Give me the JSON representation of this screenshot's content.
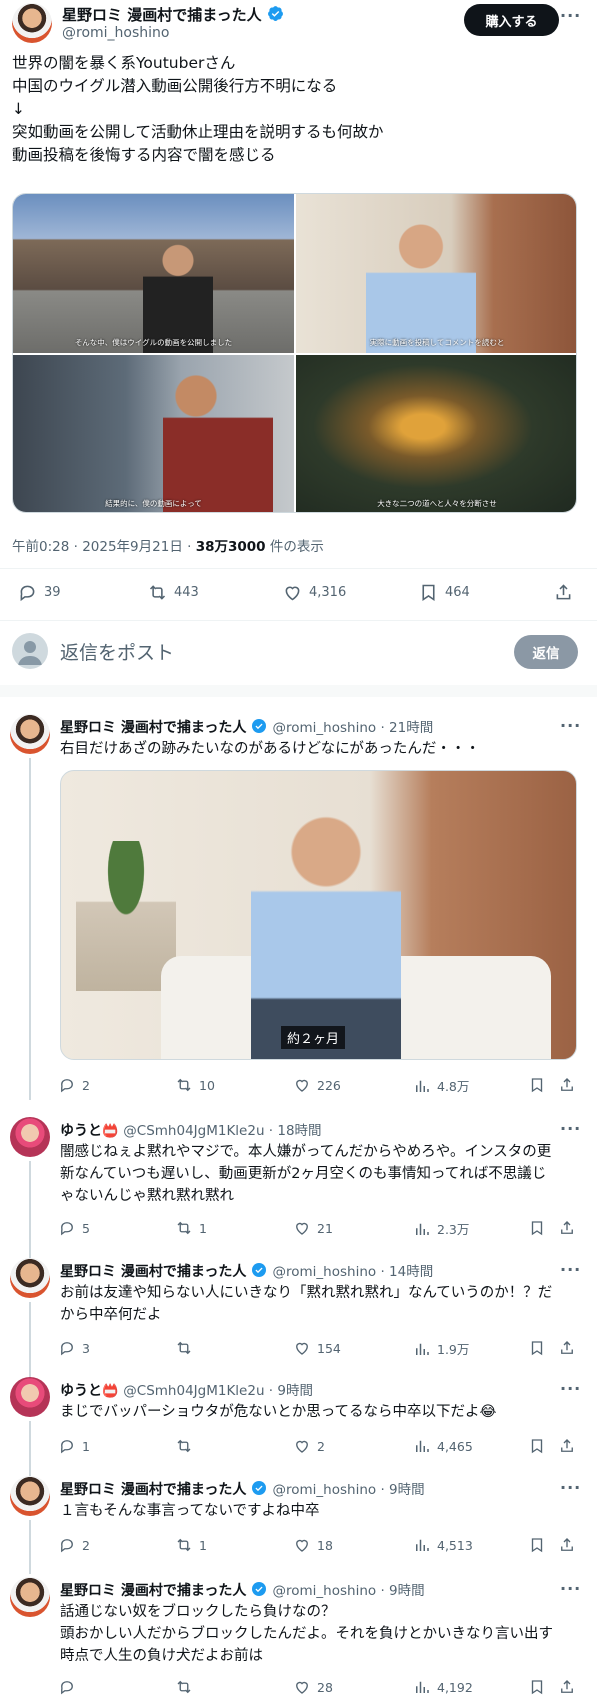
{
  "main_post": {
    "author_name": "星野ロミ 漫画村で捕まった人",
    "author_handle": "@romi_hoshino",
    "buy_button": "購入する",
    "lines": [
      "世界の闇を暴く系Youtuberさん",
      "中国のウイグル潜入動画公開後行方不明になる",
      "↓",
      "突如動画を公開して活動休止理由を説明するも何故か",
      "動画投稿を後悔する内容で闇を感じる"
    ],
    "image_captions": [
      "そんな中、僕はウイグルの動画を公開しました",
      "実際に動画を投稿してコメントを読むと",
      "結果的に、僕の動画によって",
      "大きな二つの道へと人々を分断させ"
    ],
    "timestamp": "午前0:28 · 2025年9月21日 · ",
    "views": "38万3000",
    "views_suffix": " 件の表示",
    "replies": "39",
    "reposts": "443",
    "likes": "4,316",
    "bookmarks": "464"
  },
  "reply_box": {
    "placeholder": "返信をポスト",
    "button": "返信"
  },
  "replies": [
    {
      "name": "星野ロミ 漫画村で捕まった人",
      "handle": "@romi_hoshino · 21時間",
      "verified": true,
      "lines": [
        "右目だけあざの跡みたいなのがあるけどなにがあったんだ・・・"
      ],
      "image_caption": "約２ヶ月",
      "replies": "2",
      "reposts": "10",
      "likes": "226",
      "views": "4.8万"
    },
    {
      "name": "ゆうと",
      "badge": "📛",
      "handle": "@CSmh04JgM1Kle2u · 18時間",
      "verified": false,
      "lines": [
        "闇感じねぇよ黙れやマジで。本人嫌がってんだからやめろや。インスタの更",
        "新なんていつも遅いし、動画更新が2ヶ月空くのも事情知ってれば不思議じ",
        "ゃないんじゃ黙れ黙れ黙れ"
      ],
      "replies": "5",
      "reposts": "1",
      "likes": "21",
      "views": "2.3万"
    },
    {
      "name": "星野ロミ 漫画村で捕まった人",
      "handle": "@romi_hoshino · 14時間",
      "verified": true,
      "lines": [
        "お前は友達や知らない人にいきなり「黙れ黙れ黙れ」なんていうのか！？だ",
        "から中卒何だよ"
      ],
      "replies": "3",
      "reposts": "",
      "likes": "154",
      "views": "1.9万"
    },
    {
      "name": "ゆうと",
      "badge": "📛",
      "handle": "@CSmh04JgM1Kle2u · 9時間",
      "verified": false,
      "lines": [
        "まじでバッパーショウタが危ないとか思ってるなら中卒以下だよ😂"
      ],
      "replies": "1",
      "reposts": "",
      "likes": "2",
      "views": "4,465"
    },
    {
      "name": "星野ロミ 漫画村で捕まった人",
      "handle": "@romi_hoshino · 9時間",
      "verified": true,
      "lines": [
        "１言もそんな事言ってないですよね中卒"
      ],
      "replies": "2",
      "reposts": "1",
      "likes": "18",
      "views": "4,513"
    },
    {
      "name": "星野ロミ 漫画村で捕まった人",
      "handle": "@romi_hoshino · 9時間",
      "verified": true,
      "lines": [
        "話通じない奴をブロックしたら負けなの？",
        "頭おかしい人だからブロックしたんだよ。それを負けとかいきなり言い出す",
        "時点で人生の負け犬だよお前は"
      ],
      "replies": "",
      "reposts": "",
      "likes": "28",
      "views": "4,192"
    }
  ],
  "colors": {
    "verified": "#1d9bf0",
    "text": "#0f1419",
    "secondary": "#536471",
    "reply_button": "#8b98a5"
  }
}
